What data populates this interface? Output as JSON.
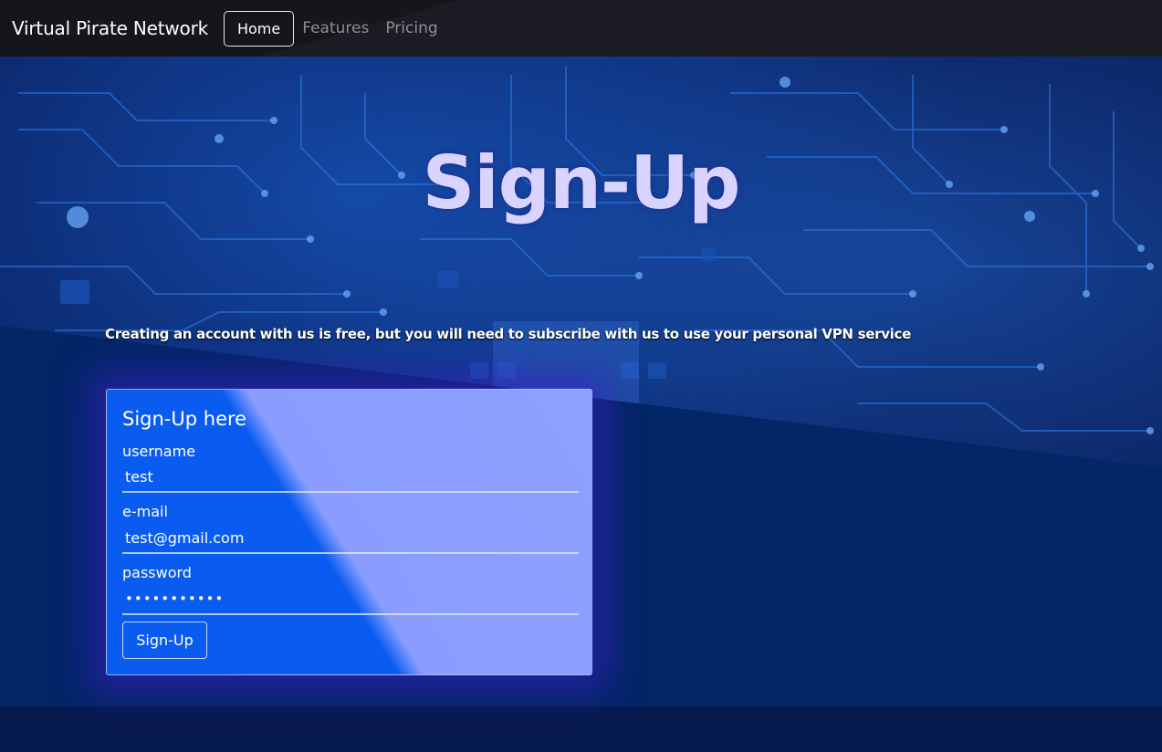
{
  "navbar": {
    "brand": "Virtual Pirate Network",
    "links": [
      {
        "label": "Home",
        "active": true
      },
      {
        "label": "Features",
        "active": false
      },
      {
        "label": "Pricing",
        "active": false
      }
    ]
  },
  "hero": {
    "title": "Sign-Up",
    "subtitle": "Creating an account with us is free, but you will need to subscribe with us to use your personal VPN service"
  },
  "form": {
    "title": "Sign-Up here",
    "username": {
      "label": "username",
      "value": "test"
    },
    "email": {
      "label": "e-mail",
      "value": "test@gmail.com"
    },
    "password": {
      "label": "password",
      "value": "•••••••••••"
    },
    "submit_label": "Sign-Up"
  },
  "colors": {
    "navbar_bg": "#1c1d24",
    "card_blue": "#0a5cf0",
    "card_lavender": "#8da0ff",
    "title_color": "#d9d4ff"
  }
}
